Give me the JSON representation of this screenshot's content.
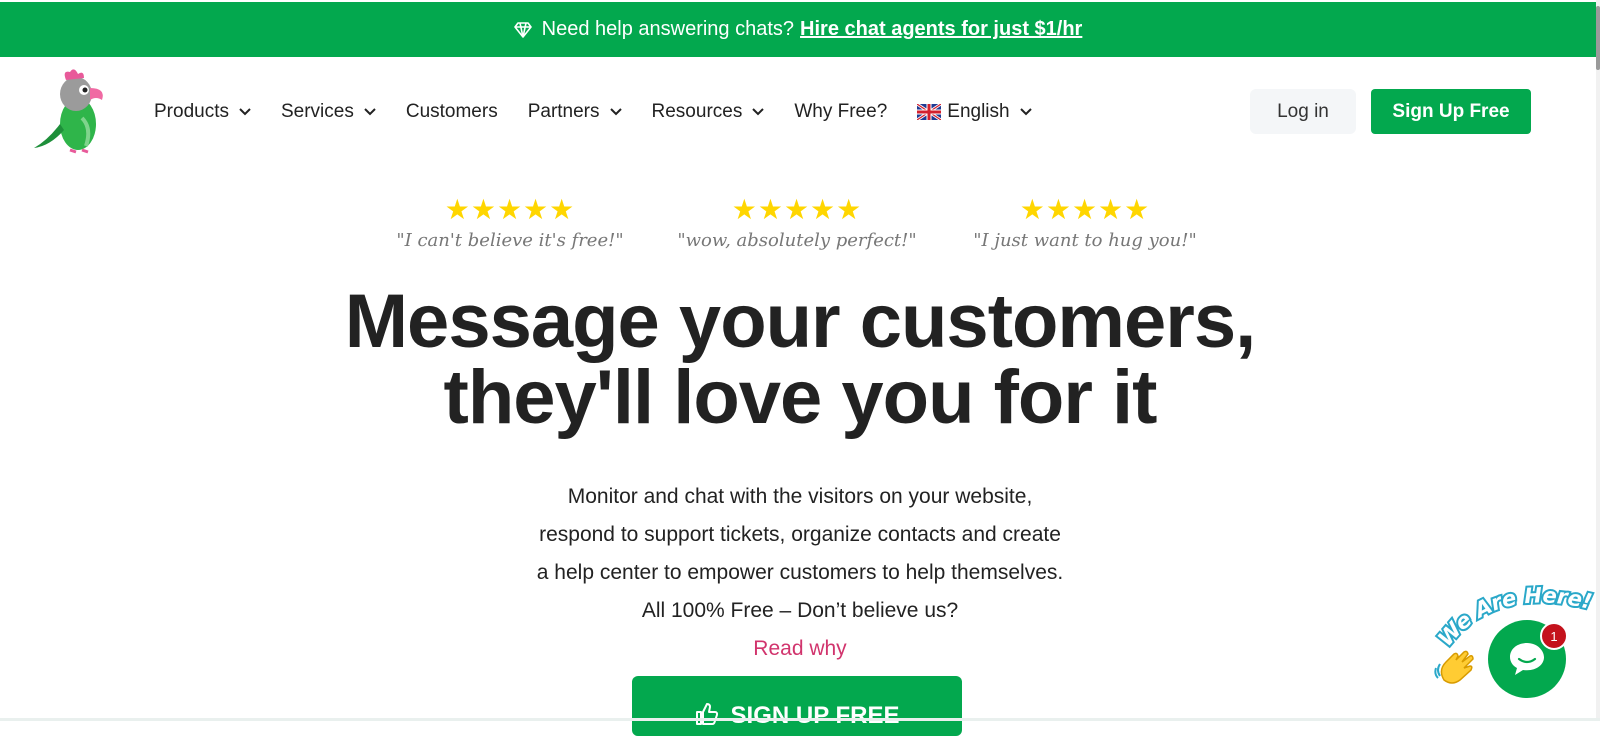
{
  "promo": {
    "text": "Need help answering chats?",
    "link": "Hire chat agents for just $1/hr"
  },
  "nav": {
    "items": [
      {
        "label": "Products",
        "dropdown": true
      },
      {
        "label": "Services",
        "dropdown": true
      },
      {
        "label": "Customers",
        "dropdown": false
      },
      {
        "label": "Partners",
        "dropdown": true
      },
      {
        "label": "Resources",
        "dropdown": true
      },
      {
        "label": "Why Free?",
        "dropdown": false
      }
    ],
    "language": "English",
    "login": "Log in",
    "signup": "Sign Up Free"
  },
  "reviews": [
    {
      "stars": 5,
      "quote": "\"I can't believe it's free!\""
    },
    {
      "stars": 5,
      "quote": "\"wow, absolutely perfect!\""
    },
    {
      "stars": 5,
      "quote": "\"I just want to hug you!\""
    }
  ],
  "hero": {
    "title_line1": "Message your customers,",
    "title_line2": "they'll love you for it",
    "desc_line1": "Monitor and chat with the visitors on your website,",
    "desc_line2": "respond to support tickets, organize contacts and create",
    "desc_line3": "a help center to empower customers to help themselves.",
    "desc_line4": "All 100% Free – Don’t believe us?",
    "read_why": "Read why",
    "cta": "SIGN UP FREE"
  },
  "chat_widget": {
    "label": "We Are Here!",
    "badge": "1"
  },
  "colors": {
    "brand_green": "#03a84e",
    "accent_pink": "#d1346d",
    "star_yellow": "#ffd600",
    "badge_red": "#c4121c"
  }
}
